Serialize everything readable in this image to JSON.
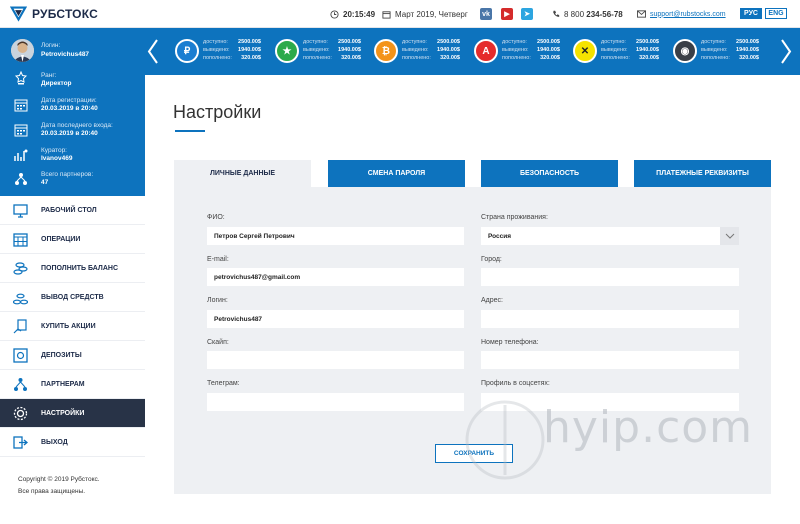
{
  "brand": {
    "name": "РУБСТОКС"
  },
  "topbar": {
    "time": "20:15:49",
    "date": "Март 2019, Четверг",
    "socials": [
      {
        "name": "vk-icon",
        "label": "vk",
        "color": "#4a76a8"
      },
      {
        "name": "youtube-icon",
        "label": "▶",
        "color": "#d52b2b"
      },
      {
        "name": "telegram-icon",
        "label": "➤",
        "color": "#2ca5e0"
      }
    ],
    "phone_prefix": "8 800",
    "phone_number": "234-56-78",
    "email": "support@rubstocks.com",
    "lang_active": "РУС",
    "lang_other": "ENG"
  },
  "ticker": {
    "labels": [
      "доступно:",
      "выведено:",
      "пополнено:"
    ],
    "items": [
      {
        "icon": "ruble-coin-icon",
        "symbol": "₽",
        "color": "#1b7ed1",
        "values": [
          "2500.00$",
          "1940.00$",
          "320.00$"
        ]
      },
      {
        "icon": "star-coin-icon",
        "symbol": "★",
        "color": "#2caa4a",
        "values": [
          "2500.00$",
          "1940.00$",
          "320.00$"
        ]
      },
      {
        "icon": "bitcoin-coin-icon",
        "symbol": "₿",
        "color": "#f3931a",
        "values": [
          "2500.00$",
          "1940.00$",
          "320.00$"
        ]
      },
      {
        "icon": "alfa-coin-icon",
        "symbol": "A",
        "color": "#e52c2c",
        "values": [
          "2500.00$",
          "1940.00$",
          "320.00$"
        ]
      },
      {
        "icon": "x-coin-icon",
        "symbol": "✕",
        "color": "#f5e300",
        "values": [
          "2500.00$",
          "1940.00$",
          "320.00$"
        ]
      },
      {
        "icon": "chart-coin-icon",
        "symbol": "◉",
        "color": "#3a3f47",
        "values": [
          "2500.00$",
          "1940.00$",
          "320.00$"
        ]
      }
    ]
  },
  "profile": {
    "login_label": "Логин:",
    "login": "Petrovichus487",
    "rank_label": "Ранг:",
    "rank": "Директор",
    "reg_label": "Дата регистрации:",
    "reg_date": "20.03.2019 в 20:40",
    "last_label": "Дата последнего входа:",
    "last_date": "20.03.2019 в 20:40",
    "curator_label": "Куратор:",
    "curator": "Ivanov469",
    "partners_label": "Всего партнеров:",
    "partners": "47"
  },
  "menu": [
    {
      "name": "menu-dashboard",
      "icon": "monitor-icon",
      "label": "РАБОЧИЙ СТОЛ"
    },
    {
      "name": "menu-operations",
      "icon": "calendar-icon",
      "label": "ОПЕРАЦИИ"
    },
    {
      "name": "menu-deposit",
      "icon": "coins-icon",
      "label": "ПОПОЛНИТЬ БАЛАНС"
    },
    {
      "name": "menu-withdraw",
      "icon": "coins-out-icon",
      "label": "ВЫВОД СРЕДСТВ"
    },
    {
      "name": "menu-buy-shares",
      "icon": "hand-document-icon",
      "label": "КУПИТЬ АКЦИИ"
    },
    {
      "name": "menu-deposits",
      "icon": "safe-icon",
      "label": "ДЕПОЗИТЫ"
    },
    {
      "name": "menu-partners",
      "icon": "network-icon",
      "label": "ПАРТНЕРАМ"
    },
    {
      "name": "menu-settings",
      "icon": "gear-icon",
      "label": "НАСТРОЙКИ"
    },
    {
      "name": "menu-logout",
      "icon": "logout-icon",
      "label": "ВЫХОД"
    }
  ],
  "footer": {
    "line1": "Copyright © 2019 Рубстокс.",
    "line2": "Все права защищены."
  },
  "page": {
    "title": "Настройки"
  },
  "tabs": [
    "ЛИЧНЫЕ ДАННЫЕ",
    "СМЕНА ПАРОЛЯ",
    "БЕЗОПАСНОСТЬ",
    "ПЛАТЕЖНЫЕ РЕКВИЗИТЫ"
  ],
  "form": {
    "fio_label": "ФИО:",
    "fio": "Петров Сергей Петрович",
    "email_label": "E-mail:",
    "email": "petrovichus487@gmail.com",
    "login_label": "Логин:",
    "login": "Petrovichus487",
    "skype_label": "Скайп:",
    "skype": "",
    "telegram_label": "Телеграм:",
    "telegram": "",
    "country_label": "Страна проживания:",
    "country": "Россия",
    "city_label": "Город:",
    "city": "",
    "address_label": "Адрес:",
    "address": "",
    "phone_label": "Номер телефона:",
    "phone": "",
    "social_label": "Профиль в соцсетях:",
    "social": "",
    "save_label": "СОХРАНИТЬ"
  },
  "watermark": "hyip.com"
}
